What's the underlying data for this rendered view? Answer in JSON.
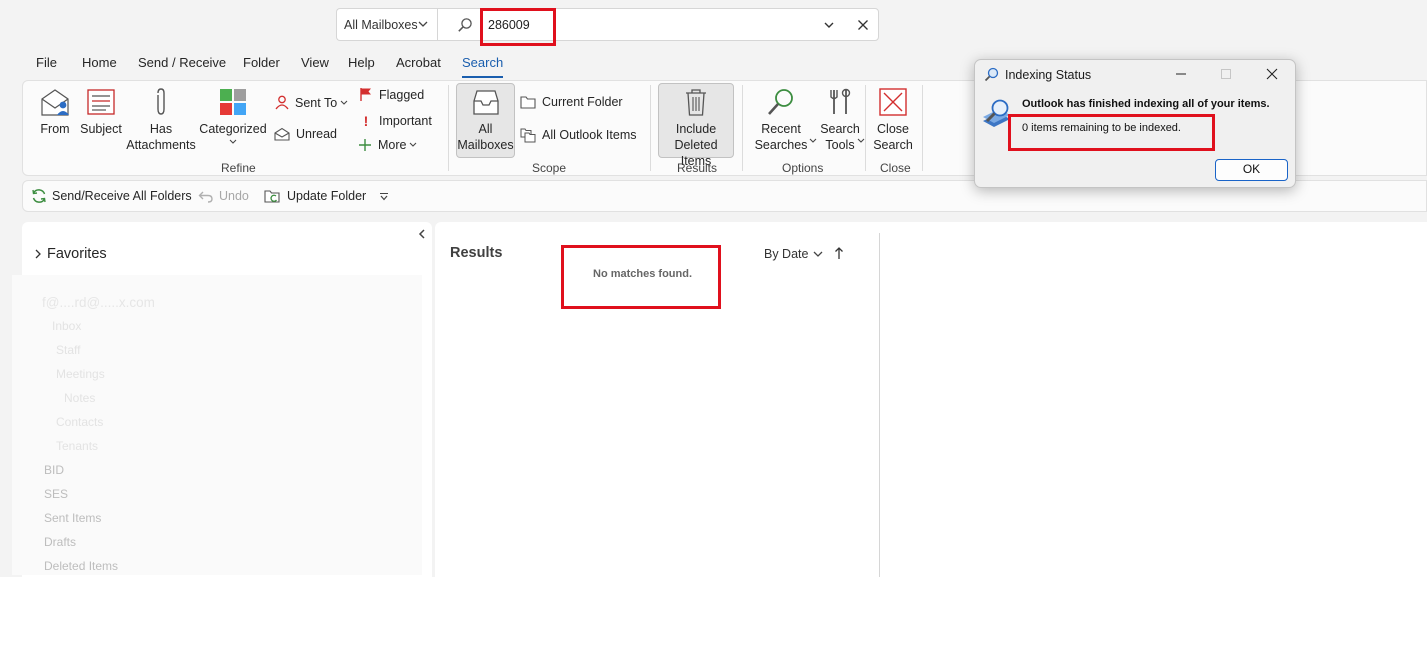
{
  "search": {
    "scope_label": "All Mailboxes",
    "query": "286009"
  },
  "menu": [
    "File",
    "Home",
    "Send / Receive",
    "Folder",
    "View",
    "Help",
    "Acrobat",
    "Search"
  ],
  "ribbon": {
    "refine": {
      "from": "From",
      "subject": "Subject",
      "has_attachments": [
        "Has",
        "Attachments"
      ],
      "categorized": "Categorized",
      "sent_to": "Sent To",
      "unread": "Unread",
      "flagged": "Flagged",
      "important": "Important",
      "more": "More",
      "group_label": "Refine"
    },
    "scope": {
      "all_mailboxes": [
        "All",
        "Mailboxes"
      ],
      "current_folder": "Current Folder",
      "all_outlook_items": "All Outlook Items",
      "group_label": "Scope"
    },
    "results": {
      "include_deleted": [
        "Include",
        "Deleted Items"
      ],
      "group_label": "Results"
    },
    "options": {
      "recent_searches": [
        "Recent",
        "Searches"
      ],
      "search_tools": [
        "Search",
        "Tools"
      ],
      "group_label": "Options"
    },
    "close": {
      "close_search": [
        "Close",
        "Search"
      ],
      "group_label": "Close"
    }
  },
  "quick_access": {
    "send_receive_all": "Send/Receive All Folders",
    "undo": "Undo",
    "update_folder": "Update Folder"
  },
  "folders": {
    "favorites": "Favorites",
    "account": "f@....rd@.....x.com",
    "items": [
      "Inbox",
      "Staff",
      "Meetings",
      "Notes",
      "Contacts",
      "Tenants",
      "BID",
      "SES",
      "Sent Items",
      "Drafts",
      "Deleted Items"
    ]
  },
  "results_pane": {
    "title": "Results",
    "empty_message": "No matches found.",
    "sort_label": "By Date"
  },
  "dialog": {
    "title": "Indexing Status",
    "message": "Outlook has finished indexing all of your items.",
    "remaining": "0 items remaining to be indexed.",
    "ok": "OK"
  },
  "colors": {
    "accent": "#1a5eae",
    "highlight_box": "#e0101d"
  }
}
